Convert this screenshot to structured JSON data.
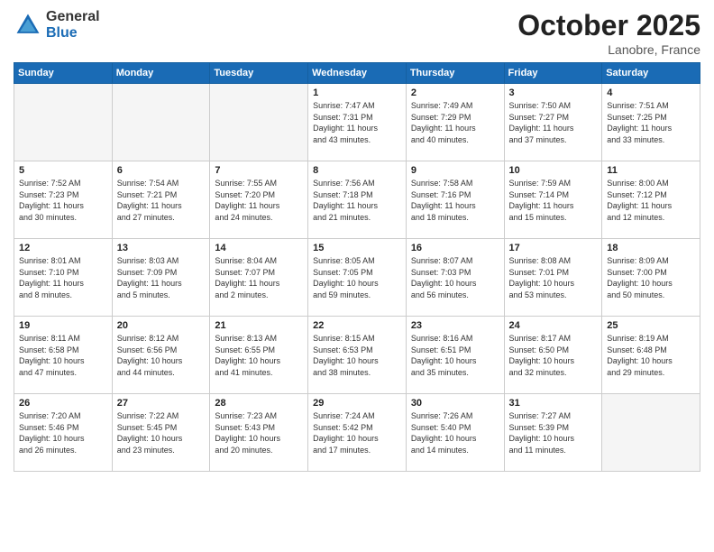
{
  "header": {
    "logo_general": "General",
    "logo_blue": "Blue",
    "month_title": "October 2025",
    "location": "Lanobre, France"
  },
  "weekdays": [
    "Sunday",
    "Monday",
    "Tuesday",
    "Wednesday",
    "Thursday",
    "Friday",
    "Saturday"
  ],
  "weeks": [
    [
      {
        "day": "",
        "info": ""
      },
      {
        "day": "",
        "info": ""
      },
      {
        "day": "",
        "info": ""
      },
      {
        "day": "1",
        "info": "Sunrise: 7:47 AM\nSunset: 7:31 PM\nDaylight: 11 hours\nand 43 minutes."
      },
      {
        "day": "2",
        "info": "Sunrise: 7:49 AM\nSunset: 7:29 PM\nDaylight: 11 hours\nand 40 minutes."
      },
      {
        "day": "3",
        "info": "Sunrise: 7:50 AM\nSunset: 7:27 PM\nDaylight: 11 hours\nand 37 minutes."
      },
      {
        "day": "4",
        "info": "Sunrise: 7:51 AM\nSunset: 7:25 PM\nDaylight: 11 hours\nand 33 minutes."
      }
    ],
    [
      {
        "day": "5",
        "info": "Sunrise: 7:52 AM\nSunset: 7:23 PM\nDaylight: 11 hours\nand 30 minutes."
      },
      {
        "day": "6",
        "info": "Sunrise: 7:54 AM\nSunset: 7:21 PM\nDaylight: 11 hours\nand 27 minutes."
      },
      {
        "day": "7",
        "info": "Sunrise: 7:55 AM\nSunset: 7:20 PM\nDaylight: 11 hours\nand 24 minutes."
      },
      {
        "day": "8",
        "info": "Sunrise: 7:56 AM\nSunset: 7:18 PM\nDaylight: 11 hours\nand 21 minutes."
      },
      {
        "day": "9",
        "info": "Sunrise: 7:58 AM\nSunset: 7:16 PM\nDaylight: 11 hours\nand 18 minutes."
      },
      {
        "day": "10",
        "info": "Sunrise: 7:59 AM\nSunset: 7:14 PM\nDaylight: 11 hours\nand 15 minutes."
      },
      {
        "day": "11",
        "info": "Sunrise: 8:00 AM\nSunset: 7:12 PM\nDaylight: 11 hours\nand 12 minutes."
      }
    ],
    [
      {
        "day": "12",
        "info": "Sunrise: 8:01 AM\nSunset: 7:10 PM\nDaylight: 11 hours\nand 8 minutes."
      },
      {
        "day": "13",
        "info": "Sunrise: 8:03 AM\nSunset: 7:09 PM\nDaylight: 11 hours\nand 5 minutes."
      },
      {
        "day": "14",
        "info": "Sunrise: 8:04 AM\nSunset: 7:07 PM\nDaylight: 11 hours\nand 2 minutes."
      },
      {
        "day": "15",
        "info": "Sunrise: 8:05 AM\nSunset: 7:05 PM\nDaylight: 10 hours\nand 59 minutes."
      },
      {
        "day": "16",
        "info": "Sunrise: 8:07 AM\nSunset: 7:03 PM\nDaylight: 10 hours\nand 56 minutes."
      },
      {
        "day": "17",
        "info": "Sunrise: 8:08 AM\nSunset: 7:01 PM\nDaylight: 10 hours\nand 53 minutes."
      },
      {
        "day": "18",
        "info": "Sunrise: 8:09 AM\nSunset: 7:00 PM\nDaylight: 10 hours\nand 50 minutes."
      }
    ],
    [
      {
        "day": "19",
        "info": "Sunrise: 8:11 AM\nSunset: 6:58 PM\nDaylight: 10 hours\nand 47 minutes."
      },
      {
        "day": "20",
        "info": "Sunrise: 8:12 AM\nSunset: 6:56 PM\nDaylight: 10 hours\nand 44 minutes."
      },
      {
        "day": "21",
        "info": "Sunrise: 8:13 AM\nSunset: 6:55 PM\nDaylight: 10 hours\nand 41 minutes."
      },
      {
        "day": "22",
        "info": "Sunrise: 8:15 AM\nSunset: 6:53 PM\nDaylight: 10 hours\nand 38 minutes."
      },
      {
        "day": "23",
        "info": "Sunrise: 8:16 AM\nSunset: 6:51 PM\nDaylight: 10 hours\nand 35 minutes."
      },
      {
        "day": "24",
        "info": "Sunrise: 8:17 AM\nSunset: 6:50 PM\nDaylight: 10 hours\nand 32 minutes."
      },
      {
        "day": "25",
        "info": "Sunrise: 8:19 AM\nSunset: 6:48 PM\nDaylight: 10 hours\nand 29 minutes."
      }
    ],
    [
      {
        "day": "26",
        "info": "Sunrise: 7:20 AM\nSunset: 5:46 PM\nDaylight: 10 hours\nand 26 minutes."
      },
      {
        "day": "27",
        "info": "Sunrise: 7:22 AM\nSunset: 5:45 PM\nDaylight: 10 hours\nand 23 minutes."
      },
      {
        "day": "28",
        "info": "Sunrise: 7:23 AM\nSunset: 5:43 PM\nDaylight: 10 hours\nand 20 minutes."
      },
      {
        "day": "29",
        "info": "Sunrise: 7:24 AM\nSunset: 5:42 PM\nDaylight: 10 hours\nand 17 minutes."
      },
      {
        "day": "30",
        "info": "Sunrise: 7:26 AM\nSunset: 5:40 PM\nDaylight: 10 hours\nand 14 minutes."
      },
      {
        "day": "31",
        "info": "Sunrise: 7:27 AM\nSunset: 5:39 PM\nDaylight: 10 hours\nand 11 minutes."
      },
      {
        "day": "",
        "info": ""
      }
    ]
  ]
}
